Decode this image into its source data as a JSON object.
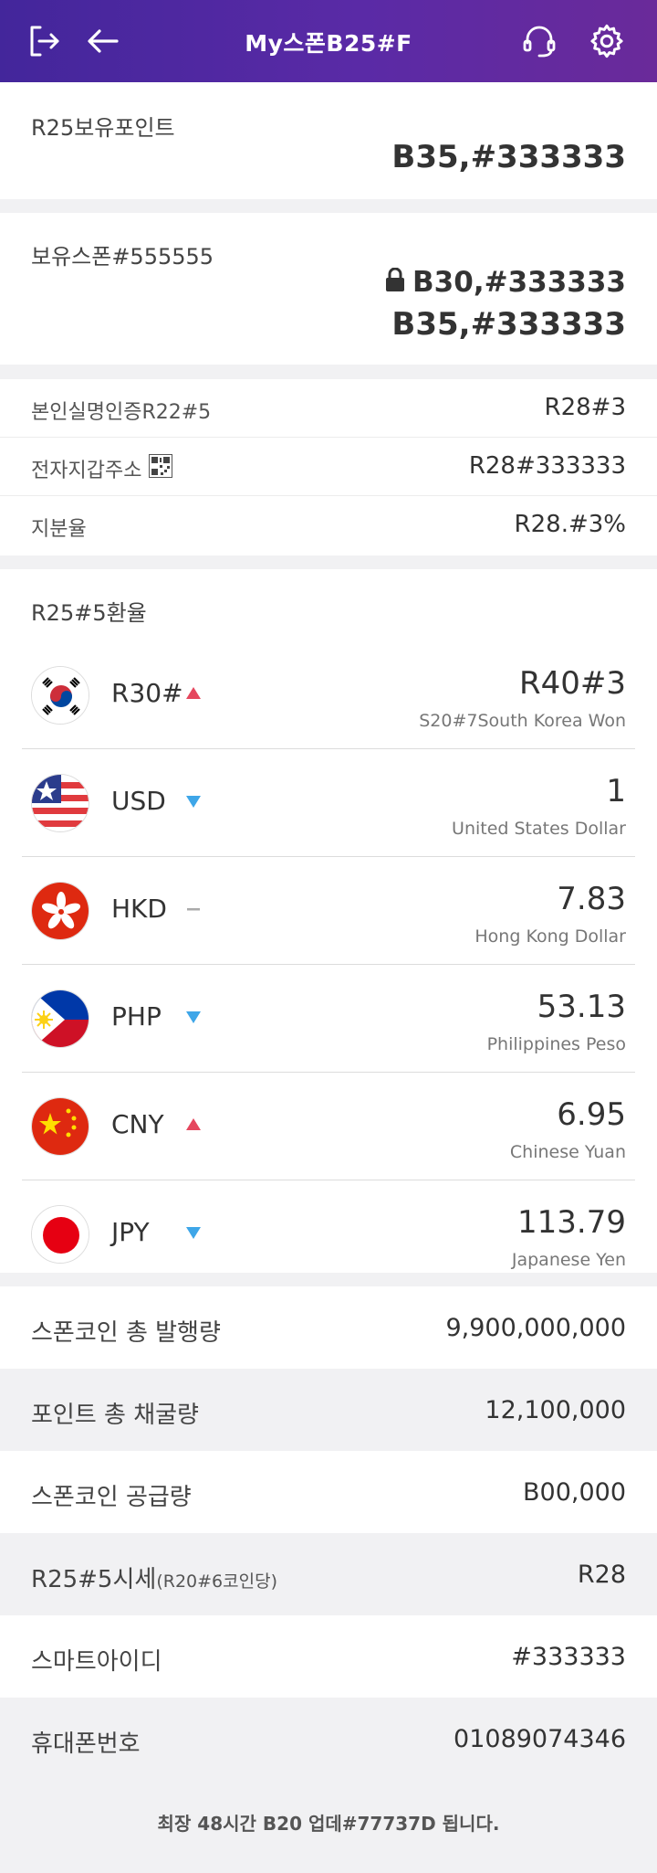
{
  "header": {
    "title": "My스폰B25#F"
  },
  "points": {
    "label": "R25보유포인트",
    "value": "B35,#333333"
  },
  "coins": {
    "label": "보유스폰#555555",
    "locked_value": "B30,#333333",
    "value": "B35,#333333"
  },
  "info": [
    {
      "label": "본인실명인증R22#5",
      "value": "R28#3"
    },
    {
      "label": "전자지갑주소",
      "value": "R28#333333"
    },
    {
      "label": "지분율",
      "value": "R28.#3%"
    }
  ],
  "exchange": {
    "title": "R25#5환율",
    "rows": [
      {
        "code": "R30#",
        "trend": "up",
        "rate": "R40#3",
        "name": "S20#7South Korea Won",
        "flag": "kr"
      },
      {
        "code": "USD",
        "trend": "down",
        "rate": "1",
        "name": "United States Dollar",
        "flag": "us"
      },
      {
        "code": "HKD",
        "trend": "flat",
        "rate": "7.83",
        "name": "Hong Kong Dollar",
        "flag": "hk"
      },
      {
        "code": "PHP",
        "trend": "down",
        "rate": "53.13",
        "name": "Philippines Peso",
        "flag": "ph"
      },
      {
        "code": "CNY",
        "trend": "up",
        "rate": "6.95",
        "name": "Chinese Yuan",
        "flag": "cn"
      },
      {
        "code": "JPY",
        "trend": "down",
        "rate": "113.79",
        "name": "Japanese Yen",
        "flag": "jp"
      }
    ]
  },
  "stats": [
    {
      "label": "스폰코인 총 발행량",
      "value": "9,900,000,000"
    },
    {
      "label": "포인트 총 채굴량",
      "value": "12,100,000"
    },
    {
      "label": "스폰코인 공급량",
      "value": "B00,000"
    },
    {
      "label": "R25#5시세",
      "sub": "(R20#6코인당)",
      "value": "R28"
    },
    {
      "label": "스마트아이디",
      "value": "#333333"
    },
    {
      "label": "휴대폰번호",
      "value": "01089074346"
    }
  ],
  "footer": "최장 48시간 B20 업데#77737D 됩니다.",
  "colors": {
    "header_start": "#43269b",
    "header_end": "#6a2a9a",
    "up": "#e5475e",
    "down": "#3ea6e8",
    "flat": "#aaaaaa"
  }
}
